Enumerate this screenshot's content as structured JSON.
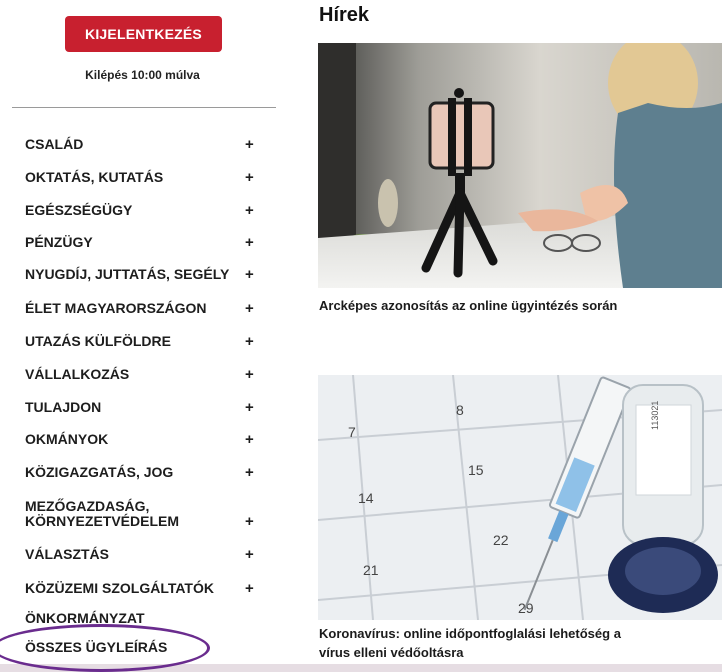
{
  "sidebar": {
    "logout_label": "KIJELENTKEZÉS",
    "logout_timer": "Kilépés 10:00 múlva",
    "menu": [
      {
        "label": "CSALÁD",
        "has_plus": true
      },
      {
        "label": "OKTATÁS, KUTATÁS",
        "has_plus": true
      },
      {
        "label": "EGÉSZSÉGÜGY",
        "has_plus": true
      },
      {
        "label": "PÉNZÜGY",
        "has_plus": true
      },
      {
        "label": "NYUGDÍJ, JUTTATÁS, SEGÉLY",
        "has_plus": true
      },
      {
        "label": "ÉLET MAGYARORSZÁGON",
        "has_plus": true
      },
      {
        "label": "UTAZÁS KÜLFÖLDRE",
        "has_plus": true
      },
      {
        "label": "VÁLLALKOZÁS",
        "has_plus": true
      },
      {
        "label": "TULAJDON",
        "has_plus": true
      },
      {
        "label": "OKMÁNYOK",
        "has_plus": true
      },
      {
        "label": "KÖZIGAZGATÁS, JOG",
        "has_plus": true
      },
      {
        "label_line1": "MEZŐGAZDASÁG,",
        "label_line2": "KÖRNYEZETVÉDELEM",
        "has_plus": true
      },
      {
        "label": "VÁLASZTÁS",
        "has_plus": true
      },
      {
        "label": "KÖZÜZEMI SZOLGÁLTATÓK",
        "has_plus": true
      },
      {
        "label": "ÖNKORMÁNYZAT",
        "has_plus": false
      },
      {
        "label": "ÖSSZES ÜGYLEÍRÁS",
        "has_plus": false
      }
    ],
    "plus_symbol": "+"
  },
  "main": {
    "title": "Hírek",
    "news": [
      {
        "caption": "Arcképes azonosítás az online ügyintézés során"
      },
      {
        "caption_line1": "Koronavírus: online időpontfoglalási lehetőség a",
        "caption_line2": "vírus elleni védőoltásra"
      }
    ]
  },
  "colors": {
    "accent_red": "#c8202f",
    "highlight_purple": "#6a2c8e",
    "frame_pink": "#e6dde3"
  }
}
